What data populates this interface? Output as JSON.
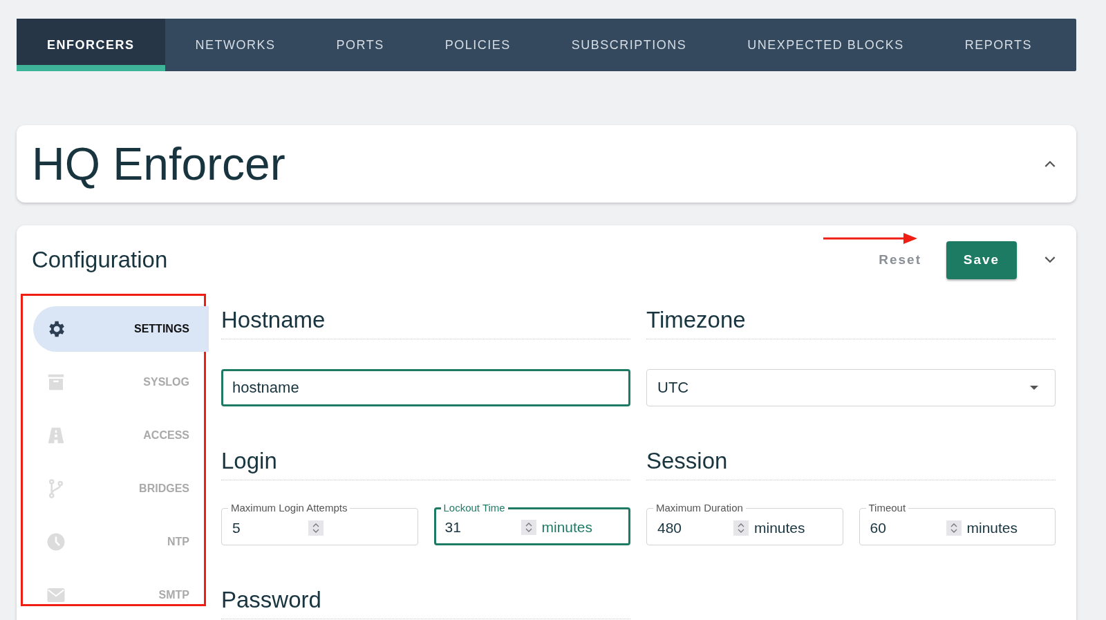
{
  "nav_tabs": [
    {
      "label": "ENFORCERS",
      "selected": true
    },
    {
      "label": "NETWORKS",
      "selected": false
    },
    {
      "label": "PORTS",
      "selected": false
    },
    {
      "label": "POLICIES",
      "selected": false
    },
    {
      "label": "SUBSCRIPTIONS",
      "selected": false
    },
    {
      "label": "UNEXPECTED BLOCKS",
      "selected": false
    },
    {
      "label": "REPORTS",
      "selected": false
    }
  ],
  "title_card": {
    "title": "HQ Enforcer",
    "expanded": true
  },
  "config_card": {
    "title": "Configuration",
    "reset_label": "Reset",
    "save_label": "Save",
    "expanded": false
  },
  "sidebar": {
    "items": [
      {
        "kind": "gear",
        "label": "SETTINGS",
        "selected": true,
        "disabled": false
      },
      {
        "kind": "archive",
        "label": "SYSLOG",
        "selected": false,
        "disabled": true
      },
      {
        "kind": "road",
        "label": "ACCESS",
        "selected": false,
        "disabled": true
      },
      {
        "kind": "branch",
        "label": "BRIDGES",
        "selected": false,
        "disabled": true
      },
      {
        "kind": "clock",
        "label": "NTP",
        "selected": false,
        "disabled": true
      },
      {
        "kind": "mail",
        "label": "SMTP",
        "selected": false,
        "disabled": true
      }
    ]
  },
  "sections": [
    {
      "heading": "Hostname",
      "kind": "text",
      "value": "hostname",
      "focused": true
    },
    {
      "heading": "Timezone",
      "kind": "select",
      "value": "UTC",
      "focused": false
    },
    {
      "heading": "Login",
      "kind": "numbers",
      "fields": [
        {
          "label": "Maximum Login Attempts",
          "value": "5",
          "focused": false
        },
        {
          "label": "Lockout Time",
          "value": "31",
          "unit": "minutes",
          "focused": true
        }
      ]
    },
    {
      "heading": "Session",
      "kind": "numbers",
      "fields": [
        {
          "label": "Maximum Duration",
          "value": "480",
          "unit": "minutes",
          "focused": false
        },
        {
          "label": "Timeout",
          "value": "60",
          "unit": "minutes",
          "focused": false
        }
      ]
    },
    {
      "heading": "Password",
      "kind": "heading"
    }
  ]
}
